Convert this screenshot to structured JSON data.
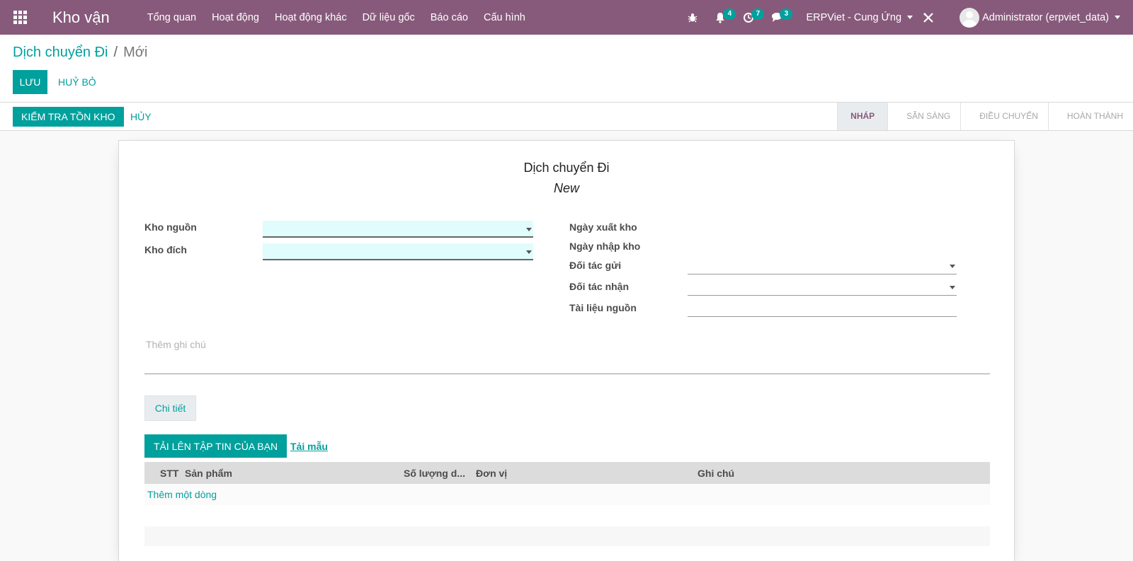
{
  "navbar": {
    "app_title": "Kho vận",
    "menu": [
      "Tổng quan",
      "Hoạt động",
      "Hoạt động khác",
      "Dữ liệu gốc",
      "Báo cáo",
      "Cấu hình"
    ],
    "notifications_count": "4",
    "activities_count": "7",
    "messages_count": "3",
    "company": "ERPViet - Cung Ứng",
    "user": "Administrator (erpviet_data)",
    "bg_color": "#875a7b"
  },
  "breadcrumb": {
    "parent": "Dịch chuyển Đi",
    "separator": "/",
    "current": "Mới"
  },
  "buttons": {
    "save": "LƯU",
    "discard": "HUỶ BỎ",
    "check_stock": "KIỂM TRA TỒN KHO",
    "cancel": "HỦY",
    "upload": "TẢI LÊN TẬP TIN CỦA BẠN",
    "template": "Tải mẫu"
  },
  "stages": [
    "NHÁP",
    "SẴN SÀNG",
    "ĐIỀU CHUYỂN",
    "HOÀN THÀNH"
  ],
  "sheet": {
    "title": "Dịch chuyển Đi",
    "name": "New"
  },
  "form": {
    "source_warehouse_label": "Kho nguồn",
    "source_warehouse_value": "",
    "dest_warehouse_label": "Kho đích",
    "dest_warehouse_value": "",
    "export_date_label": "Ngày xuất kho",
    "import_date_label": "Ngày nhập kho",
    "sender_label": "Đối tác gửi",
    "receiver_label": "Đối tác nhận",
    "source_doc_label": "Tài liệu nguồn",
    "note_placeholder": "Thêm ghi chú"
  },
  "tabs": [
    "Chi tiết"
  ],
  "table": {
    "columns": [
      "STT",
      "Sản phẩm",
      "Số lượng d...",
      "Đơn vị",
      "Ghi chú"
    ],
    "add_line": "Thêm một dòng"
  },
  "accent_color": "#00a09d"
}
